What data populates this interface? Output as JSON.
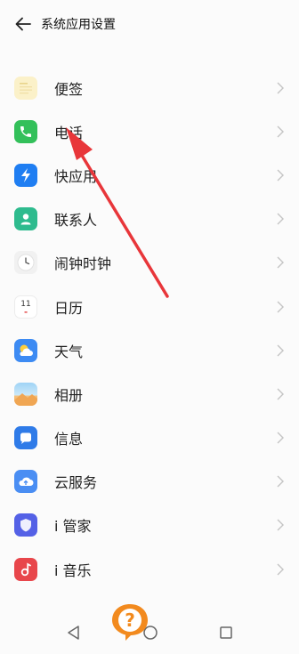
{
  "header": {
    "title": "系统应用设置"
  },
  "list": {
    "items": [
      {
        "label": "便签",
        "icon": "notes-icon"
      },
      {
        "label": "电话",
        "icon": "phone-icon"
      },
      {
        "label": "快应用",
        "icon": "quick-app-icon"
      },
      {
        "label": "联系人",
        "icon": "contacts-icon"
      },
      {
        "label": "闹钟时钟",
        "icon": "clock-icon"
      },
      {
        "label": "日历",
        "icon": "calendar-icon",
        "calendar_day": "11"
      },
      {
        "label": "天气",
        "icon": "weather-icon"
      },
      {
        "label": "相册",
        "icon": "album-icon"
      },
      {
        "label": "信息",
        "icon": "messages-icon"
      },
      {
        "label": "云服务",
        "icon": "cloud-service-icon"
      },
      {
        "label": "i 管家",
        "icon": "i-manager-icon"
      },
      {
        "label": "i 音乐",
        "icon": "i-music-icon"
      }
    ]
  },
  "annotation": {
    "arrow_color": "#e8363a",
    "badge_color": "#f28a1e",
    "badge_symbol": "?"
  }
}
